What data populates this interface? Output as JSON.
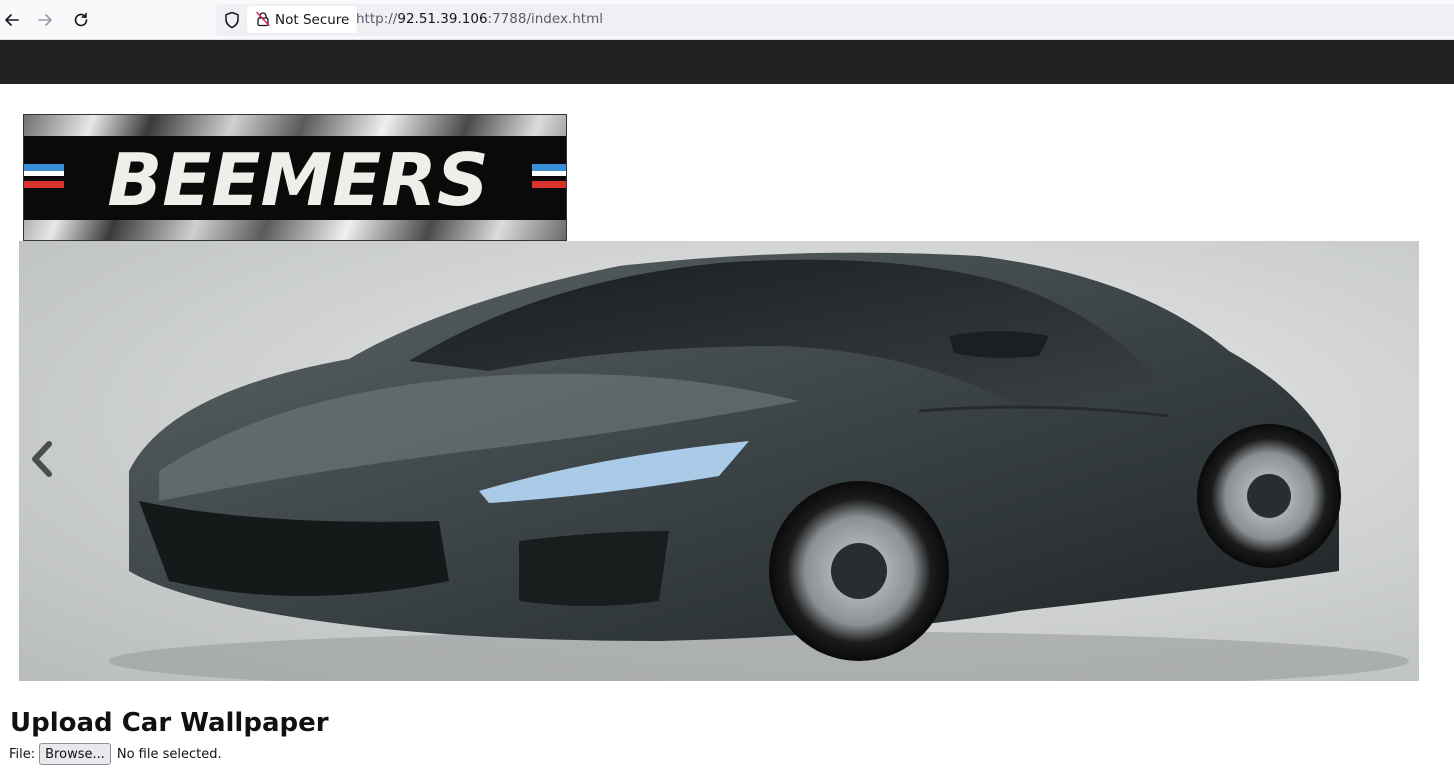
{
  "browser": {
    "security_label": "Not Secure",
    "url_prefix": "http://",
    "url_host": "92.51.39.106",
    "url_rest": ":7788/index.html"
  },
  "logo": {
    "text": "BEEMERS",
    "stripe_colors": [
      "#3a8fd6",
      "#ffffff",
      "#d8322c"
    ]
  },
  "carousel": {
    "prev_icon": "chevron-left-icon"
  },
  "upload": {
    "heading": "Upload Car Wallpaper",
    "file_label": "File:",
    "browse_label": "Browse...",
    "status": "No file selected."
  }
}
